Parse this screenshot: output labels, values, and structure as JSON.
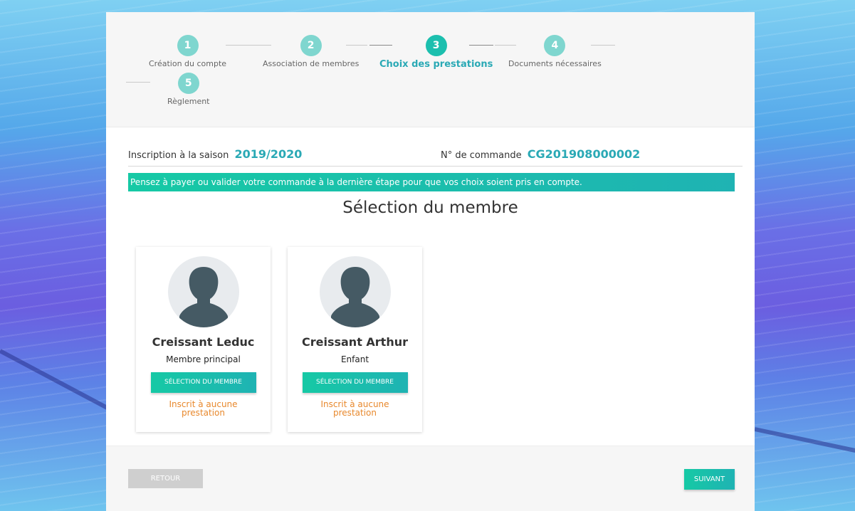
{
  "stepper": {
    "steps": [
      {
        "number": "1",
        "label": "Création du compte"
      },
      {
        "number": "2",
        "label": "Association de membres"
      },
      {
        "number": "3",
        "label": "Choix des prestations"
      },
      {
        "number": "4",
        "label": "Documents nécessaires"
      },
      {
        "number": "5",
        "label": "Règlement"
      }
    ],
    "active_step": 3
  },
  "order": {
    "season_label": "Inscription à la saison",
    "season_value": "2019/2020",
    "order_label": "N° de commande",
    "order_value": "CG201908000002"
  },
  "banner": {
    "text": "Pensez à payer ou valider votre commande à la dernière étape pour que vos choix soient pris en compte."
  },
  "section": {
    "title": "Sélection du membre"
  },
  "members": [
    {
      "name": "Creissant Leduc",
      "role": "Membre principal",
      "button_label": "SÉLECTION DU MEMBRE",
      "status": "Inscrit à aucune prestation"
    },
    {
      "name": "Creissant Arthur",
      "role": "Enfant",
      "button_label": "SÉLECTION DU MEMBRE",
      "status": "Inscrit à aucune prestation"
    }
  ],
  "footer": {
    "back_label": "RETOUR",
    "next_label": "SUIVANT"
  },
  "colors": {
    "accent": "#1cbfae",
    "accent_text": "#2aa9b5",
    "status": "#e8882c"
  }
}
